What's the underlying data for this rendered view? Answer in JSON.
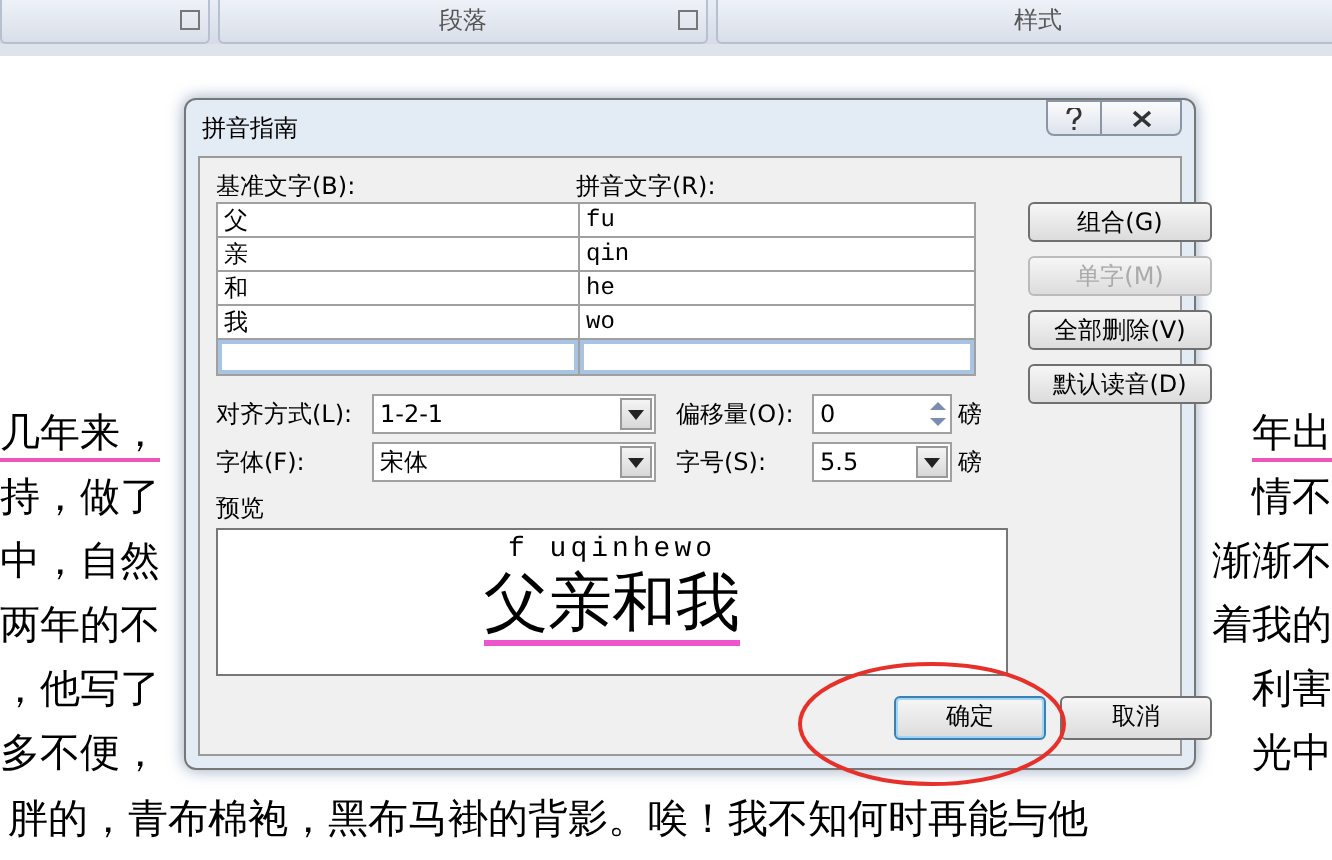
{
  "ribbon": {
    "groups": [
      {
        "launcher": true
      },
      {
        "label": "段落",
        "launcher": true
      },
      {
        "label": "样式",
        "launcher": false
      }
    ]
  },
  "document": {
    "lines": [
      {
        "left": "几年来，",
        "right": "年出",
        "underlined": true
      },
      {
        "left": "持，做了",
        "right": "情不",
        "underlined": false
      },
      {
        "left": "中，自然",
        "right": "渐渐不",
        "underlined": false
      },
      {
        "left": "两年的不",
        "right": "着我的",
        "underlined": false
      },
      {
        "left": "，他写了",
        "right": "利害",
        "underlined": false
      },
      {
        "left": "多不便，",
        "right": "光中",
        "underlined": false
      }
    ],
    "last_line": "胖的，青布棉袍，黑布马褂的背影。唉！我不知何时再能与他"
  },
  "dialog": {
    "title": "拼音指南",
    "base_label": "基准文字(B):",
    "ruby_label": "拼音文字(R):",
    "rows": [
      {
        "base": "父",
        "ruby": "fu"
      },
      {
        "base": "亲",
        "ruby": "qin"
      },
      {
        "base": "和",
        "ruby": "he"
      },
      {
        "base": "我",
        "ruby": "wo"
      }
    ],
    "side_buttons": [
      {
        "label": "组合(G)",
        "disabled": false
      },
      {
        "label": "单字(M)",
        "disabled": true
      },
      {
        "label": "全部删除(V)",
        "disabled": false
      },
      {
        "label": "默认读音(D)",
        "disabled": false
      }
    ],
    "alignment": {
      "label": "对齐方式(L):",
      "value": "1-2-1"
    },
    "offset": {
      "label": "偏移量(O):",
      "value": "0",
      "unit": "磅"
    },
    "font": {
      "label": "字体(F):",
      "value": "宋体"
    },
    "size": {
      "label": "字号(S):",
      "value": "5.5",
      "unit": "磅"
    },
    "preview_label": "预览",
    "preview_ruby": "f uqinhewo",
    "preview_text": "父亲和我",
    "buttons": [
      {
        "label": "确定",
        "default": true
      },
      {
        "label": "取消",
        "default": false
      }
    ]
  }
}
